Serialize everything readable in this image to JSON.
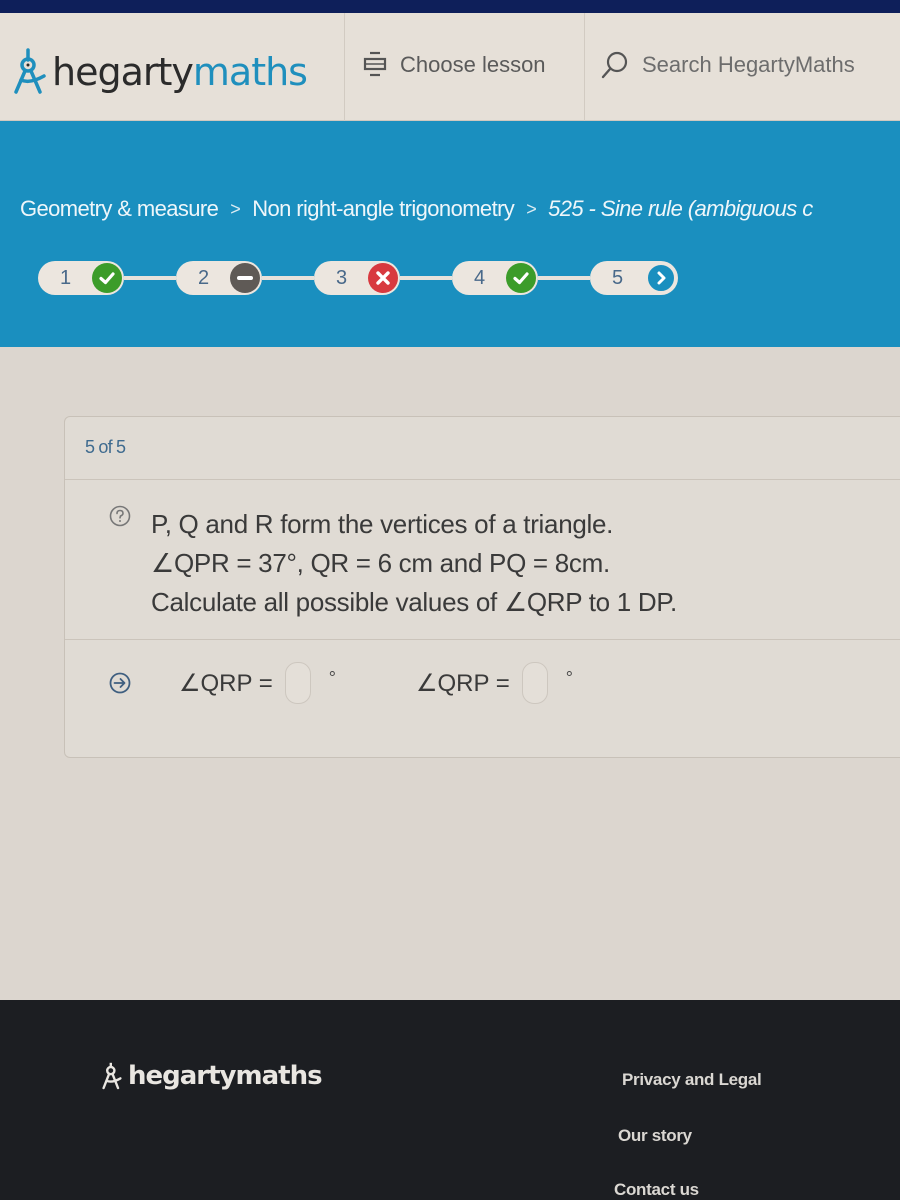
{
  "header": {
    "logo": {
      "part1": "hegarty",
      "part2": "maths",
      "icon": "compass-icon"
    },
    "choose_lesson_label": "Choose lesson",
    "choose_lesson_icon": "lesson-stack-icon",
    "search_placeholder": "Search HegartyMaths",
    "search_icon": "search-icon"
  },
  "breadcrumb": {
    "items": [
      "Geometry & measure",
      "Non right-angle trigonometry",
      "525 - Sine rule (ambiguous c"
    ],
    "separator": ">"
  },
  "progress": {
    "steps": [
      {
        "number": "1",
        "status": "correct"
      },
      {
        "number": "2",
        "status": "skipped"
      },
      {
        "number": "3",
        "status": "incorrect"
      },
      {
        "number": "4",
        "status": "correct"
      },
      {
        "number": "5",
        "status": "current"
      }
    ]
  },
  "question": {
    "counter": "5 of 5",
    "lines": [
      "P, Q and R form the vertices of a triangle.",
      "∠QPR = 37°, QR = 6 cm and PQ = 8cm.",
      "Calculate all possible values of ∠QRP to 1 DP."
    ],
    "answers": [
      {
        "label": "∠QRP =",
        "value": "",
        "unit": "°"
      },
      {
        "label": "∠QRP =",
        "value": "",
        "unit": "°"
      }
    ]
  },
  "footer": {
    "logo": "hegartymaths",
    "links": [
      "Privacy and Legal",
      "Our story",
      "Contact us"
    ]
  },
  "colors": {
    "brand_blue": "#1a8fbf",
    "correct_green": "#3c9c2a",
    "incorrect_red": "#d8393f",
    "skipped_grey": "#5f5a56",
    "footer_bg": "#1c1e22"
  }
}
